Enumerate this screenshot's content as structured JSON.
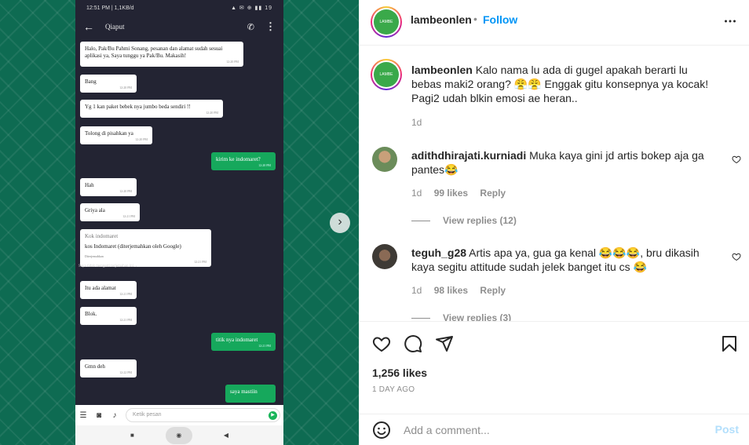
{
  "phone": {
    "status_time": "12:51 PM | 1,1KB/d",
    "status_right": "▲ ✉ ⊕ ▮▮ 19",
    "contact_name": "Qiaput",
    "messages": [
      {
        "dir": "in",
        "text": "Halo, Pak/Bu Pahmi Sonang, pesanan dan alamat sudah sesuai aplikasi ya, Saya tunggu ya Pak/Bu. Makasih!",
        "time": "12:20 PM"
      },
      {
        "dir": "in",
        "text": "Bang",
        "time": "12:20 PM"
      },
      {
        "dir": "in",
        "text": "Yg 1 kan paket bebek nya jumbo beda sendiri !!",
        "time": "12:20 PM"
      },
      {
        "dir": "in",
        "text": "Tolong di pisahkan ya",
        "time": "12:20 PM"
      },
      {
        "dir": "out",
        "text": "kirim ke indomaret?",
        "time": "12:20 PM"
      },
      {
        "dir": "in",
        "text": "Hah",
        "time": "12:20 PM"
      },
      {
        "dir": "in",
        "text": "Griya ala",
        "time": "12:21 PM"
      },
      {
        "dir": "in",
        "sub": "Kok indomaret",
        "text": "kos Indomaret (diterjemahkan oleh Google)",
        "note": "Diterjemahkan",
        "time": "12:21 PM"
      },
      {
        "dir": "in",
        "text": "Itu ada alamat",
        "time": "12:21 PM"
      },
      {
        "dir": "in",
        "text": "Blok.",
        "time": "12:21 PM"
      },
      {
        "dir": "out",
        "text": "titik nya indomaret",
        "time": "12:21 PM"
      },
      {
        "dir": "in",
        "text": "Gmn deh",
        "time": "12:22 PM"
      },
      {
        "dir": "out",
        "text": "saya mastiin",
        "time": ""
      }
    ],
    "translate_note": "Saya tidak mengerti terjemahan ini.",
    "input_placeholder": "Ketik pesan"
  },
  "post": {
    "author": "lambeonlen",
    "avatar_text": "LAMBE",
    "follow_label": "Follow",
    "dot": "•",
    "caption_author": "lambeonlen",
    "caption": "Kalo nama lu ada di gugel apakah berarti lu bebas maki2 orang? 😤😤 Enggak gitu konsepnya ya kocak! Pagi2 udah blkin emosi ae heran..",
    "caption_age": "1d",
    "comments": [
      {
        "user": "adithdhirajati.kurniadi",
        "text": "Muka kaya gini jd artis bokep aja ga pantes😂",
        "age": "1d",
        "likes": "99 likes",
        "reply_label": "Reply",
        "view_replies": "View replies (12)"
      },
      {
        "user": "teguh_g28",
        "text": "Artis apa ya, gua ga kenal 😂😂😂, bru dikasih kaya segitu attitude sudah jelek banget itu cs 😂",
        "age": "1d",
        "likes": "98 likes",
        "reply_label": "Reply",
        "view_replies": "View replies (3)"
      }
    ],
    "likes": "1,256 likes",
    "date": "1 DAY AGO",
    "comment_placeholder": "Add a comment...",
    "post_label": "Post"
  },
  "colors": {
    "follow": "#0095f6",
    "wa_green": "#16a85c",
    "media_bg": "#0e6b52"
  },
  "icons": [
    "heart-icon",
    "comment-icon",
    "share-icon",
    "bookmark-icon",
    "more-icon",
    "emoji-icon",
    "chevron-right-icon"
  ]
}
